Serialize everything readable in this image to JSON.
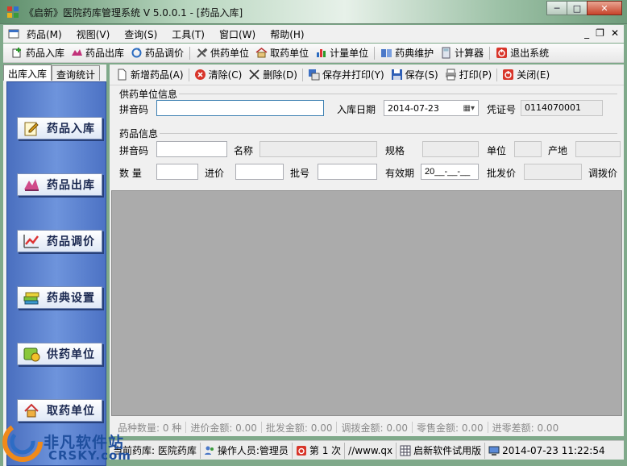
{
  "window": {
    "title": "《启新》医院药库管理系统 V 5.0.0.1 - [药品入库]",
    "controls": {
      "minimize": "─",
      "maximize": "□",
      "close": "✕"
    }
  },
  "menubar": {
    "items": [
      "药品(M)",
      "视图(V)",
      "查询(S)",
      "工具(T)",
      "窗口(W)",
      "帮助(H)"
    ],
    "mdi_controls": {
      "minimize": "_",
      "restore": "❐",
      "close": "✕"
    }
  },
  "toolbar": {
    "items": [
      "药品入库",
      "药品出库",
      "药品调价",
      "供药单位",
      "取药单位",
      "计量单位",
      "药典维护",
      "计算器",
      "退出系统"
    ]
  },
  "left_panel": {
    "tabs": [
      "出库入库",
      "查询统计"
    ],
    "nav_buttons": [
      "药品入库",
      "药品出库",
      "药品调价",
      "药典设置",
      "供药单位",
      "取药单位"
    ]
  },
  "form_toolbar": {
    "items": [
      "新增药品(A)",
      "清除(C)",
      "删除(D)",
      "保存并打印(Y)",
      "保存(S)",
      "打印(P)",
      "关闭(E)"
    ]
  },
  "supplier": {
    "section_title": "供药单位信息",
    "pinyin_label": "拼音码",
    "pinyin_value": "",
    "date_label": "入库日期",
    "date_value": "2014-07-23",
    "voucher_label": "凭证号",
    "voucher_value": "0114070001"
  },
  "drug": {
    "section_title": "药品信息",
    "pinyin_label": "拼音码",
    "name_label": "名称",
    "spec_label": "规格",
    "unit_label": "单位",
    "origin_label": "产地",
    "qty_label": "数  量",
    "purchase_price_label": "进价",
    "batch_label": "批号",
    "expiry_label": "有效期",
    "expiry_value": "20__-__-__",
    "wholesale_label": "批发价",
    "transfer_label": "调拨价"
  },
  "summary": {
    "items": [
      "品种数量:  0  种",
      "进价金额:  0.00",
      "批发金额:  0.00",
      "调拨金额:  0.00",
      "零售金额:  0.00",
      "进零差额:  0.00"
    ]
  },
  "statusbar": {
    "pharmacy": "当前药库:  医院药库",
    "operator": "操作人员:管理员",
    "count": "第 1 次",
    "url": "//www.qx",
    "version": "启新软件试用版",
    "datetime": "2014-07-23 11:22:54"
  },
  "watermark": {
    "brand": "非凡软件站",
    "site": "CRSKY.com"
  },
  "colors": {
    "nav_bg": "#6e94dc",
    "grid_bg": "#ababab",
    "accent_red": "#d8352a"
  }
}
